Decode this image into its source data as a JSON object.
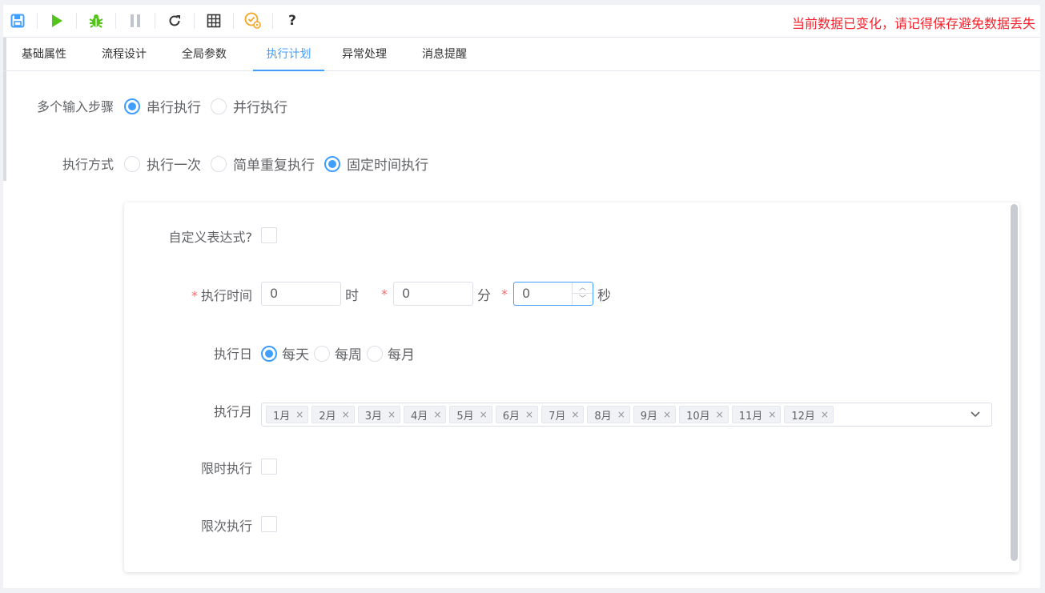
{
  "toolbar": {
    "icons": [
      "save-icon",
      "play-icon",
      "debug-bug-icon",
      "pause-icon",
      "refresh-icon",
      "grid-icon",
      "settings-badge-icon"
    ],
    "help_label": "?",
    "warning": "当前数据已变化，请记得保存避免数据丢失",
    "colors": {
      "save": "#409eff",
      "play": "#52c41a",
      "debug": "#52c41a",
      "pause": "#c0c4cc",
      "badge": "#f5a623",
      "warning": "#f5222d"
    }
  },
  "tabs": [
    "基础属性",
    "流程设计",
    "全局参数",
    "执行计划",
    "异常处理",
    "消息提醒"
  ],
  "active_tab": "执行计划",
  "form": {
    "multi_input": {
      "label": "多个输入步骤",
      "options": [
        "串行执行",
        "并行执行"
      ],
      "selected": "串行执行"
    },
    "exec_mode": {
      "label": "执行方式",
      "options": [
        "执行一次",
        "简单重复执行",
        "固定时间执行"
      ],
      "selected": "固定时间执行"
    }
  },
  "panel": {
    "custom_expr_label": "自定义表达式?",
    "exec_time": {
      "label": "执行时间",
      "required_mark": "*",
      "hour": "0",
      "hour_unit": "时",
      "minute": "0",
      "minute_unit": "分",
      "second": "0",
      "second_unit": "秒"
    },
    "exec_day": {
      "label": "执行日",
      "options": [
        "每天",
        "每周",
        "每月"
      ],
      "selected": "每天"
    },
    "exec_month": {
      "label": "执行月",
      "tags": [
        "1月",
        "2月",
        "3月",
        "4月",
        "5月",
        "6月",
        "7月",
        "8月",
        "9月",
        "10月",
        "11月",
        "12月"
      ],
      "tag_close": "×"
    },
    "time_limit_label": "限时执行",
    "count_limit_label": "限次执行"
  }
}
